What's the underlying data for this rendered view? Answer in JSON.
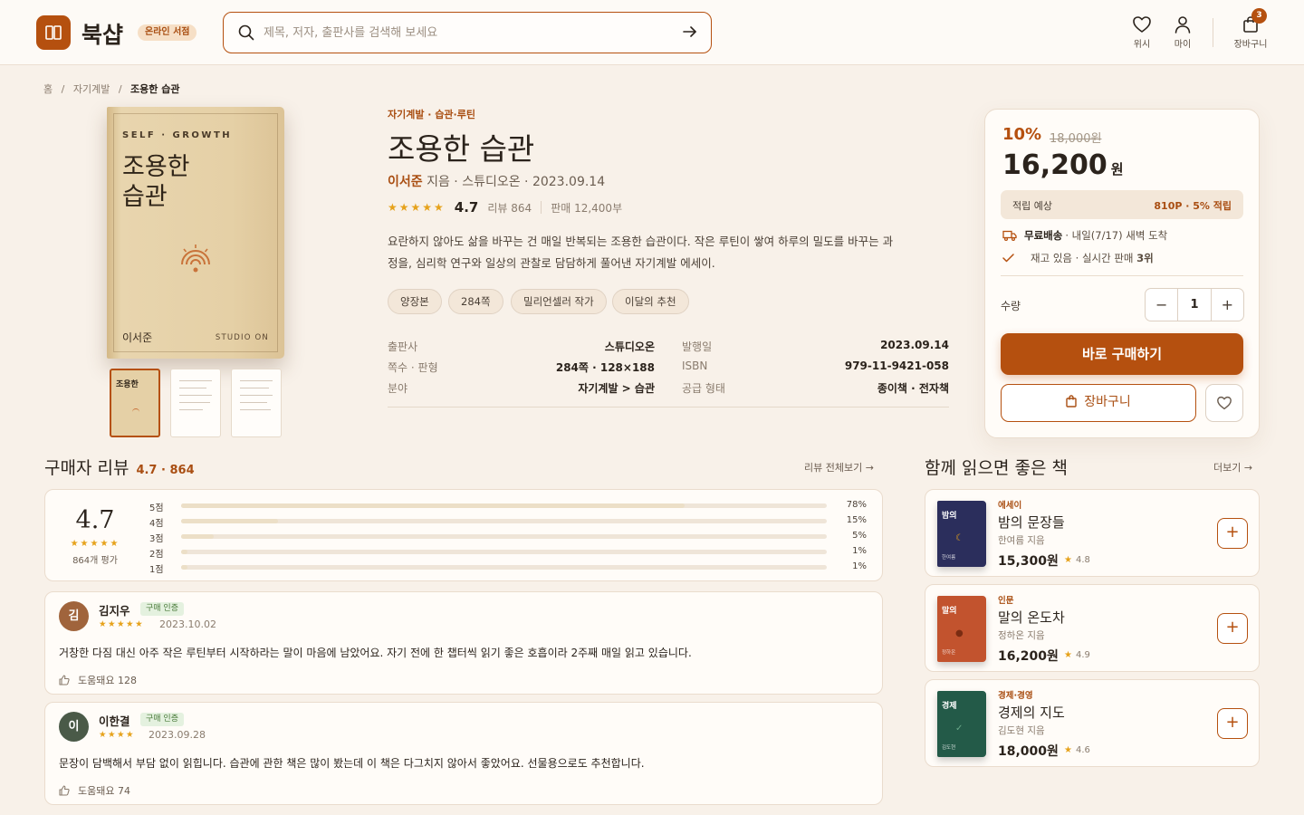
{
  "header": {
    "brand": "북샵",
    "online_badge": "온라인 서점",
    "search_placeholder": "제목, 저자, 출판사를 검색해 보세요",
    "wish_label": "위시",
    "my_label": "마이",
    "cart_label": "장바구니",
    "cart_count": "3"
  },
  "breadcrumb": [
    "홈",
    "/",
    "자기계발",
    "/",
    "조용한 습관"
  ],
  "cover": {
    "series": "SELF · GROWTH",
    "title": "조용한\n습관",
    "author": "이서준",
    "publisher": "STUDIO ON",
    "thumb_title": "조용한"
  },
  "book": {
    "category": "자기계발 · 습관·루틴",
    "title": "조용한 습관",
    "author": "이서준",
    "author_suffix": " 지음",
    "meta": " · 스튜디오온 · 2023.09.14",
    "stars": "★★★★★",
    "score": "4.7",
    "reviews": "리뷰 864",
    "sales": "판매 12,400부",
    "description": "요란하지 않아도 삶을 바꾸는 건 매일 반복되는 조용한 습관이다. 작은 루틴이 쌓여 하루의 밀도를 바꾸는 과정을, 심리학 연구와 일상의 관찰로 담담하게 풀어낸 자기계발 에세이.",
    "tags": [
      "양장본",
      "284쪽",
      "밀리언셀러 작가",
      "이달의 추천"
    ]
  },
  "specs": [
    {
      "k": "출판사",
      "v": "스튜디오온"
    },
    {
      "k": "발행일",
      "v": "2023.09.14"
    },
    {
      "k": "쪽수 · 판형",
      "v": "284쪽 · 128×188"
    },
    {
      "k": "ISBN",
      "v": "979-11-9421-058"
    },
    {
      "k": "분야",
      "v": "자기계발 > 습관"
    },
    {
      "k": "공급 형태",
      "v": "종이책 · 전자책"
    }
  ],
  "buybox": {
    "discount": "10%",
    "original": "18,000원",
    "price": "16,200",
    "price_unit": "원",
    "points_label": "적립 예상",
    "points_value": "810P · 5% 적립",
    "ship_bold": "무료배송",
    "ship_text": "· 내일(7/17) 새벽 도착",
    "stock_text": "재고 있음 · 실시간 판매 ",
    "stock_rank": "3위",
    "qty_label": "수량",
    "qty_minus": "−",
    "qty_value": "1",
    "qty_plus": "+",
    "buy_now": "바로 구매하기",
    "add_cart": "장바구니"
  },
  "reviews": {
    "heading": "구매자 리뷰",
    "sub": "4.7 · 864",
    "more": "리뷰 전체보기 →",
    "avg": "4.7",
    "avg_stars": "★★★★★",
    "count": "864개 평가",
    "dist": [
      {
        "label": "5점",
        "pct": "78%",
        "v": 78
      },
      {
        "label": "4점",
        "pct": "15%",
        "v": 15
      },
      {
        "label": "3점",
        "pct": "5%",
        "v": 5
      },
      {
        "label": "2점",
        "pct": "1%",
        "v": 1
      },
      {
        "label": "1점",
        "pct": "1%",
        "v": 1
      }
    ],
    "items": [
      {
        "initial": "김",
        "name": "김지우",
        "verified": "구매 인증",
        "stars": "★★★★★",
        "date": "2023.10.02",
        "text": "거창한 다짐 대신 아주 작은 루틴부터 시작하라는 말이 마음에 남았어요. 자기 전에 한 챕터씩 읽기 좋은 호흡이라 2주째 매일 읽고 있습니다.",
        "helpful": "도움돼요 128",
        "color": "#a0643c"
      },
      {
        "initial": "이",
        "name": "이한결",
        "verified": "구매 인증",
        "stars": "★★★★",
        "date": "2023.09.28",
        "text": "문장이 담백해서 부담 없이 읽힙니다. 습관에 관한 책은 많이 봤는데 이 책은 다그치지 않아서 좋았어요. 선물용으로도 추천합니다.",
        "helpful": "도움돼요 74",
        "color": "#4a5a48"
      }
    ]
  },
  "recs": {
    "heading": "함께 읽으면 좋은 책",
    "more": "더보기 →",
    "items": [
      {
        "category": "에세이",
        "title": "밤의 문장들",
        "author": "한여름 지음",
        "price": "15,300원",
        "rating": "4.8",
        "cover_title": "밤의",
        "cover_author": "한여름",
        "color": "#2b2e5c"
      },
      {
        "category": "인문",
        "title": "말의 온도차",
        "author": "정하온 지음",
        "price": "16,200원",
        "rating": "4.9",
        "cover_title": "말의",
        "cover_author": "정하온",
        "color": "#c2532e"
      },
      {
        "category": "경제·경영",
        "title": "경제의 지도",
        "author": "김도현 지음",
        "price": "18,000원",
        "rating": "4.6",
        "cover_title": "경제",
        "cover_author": "김도현",
        "color": "#235a48"
      }
    ]
  }
}
